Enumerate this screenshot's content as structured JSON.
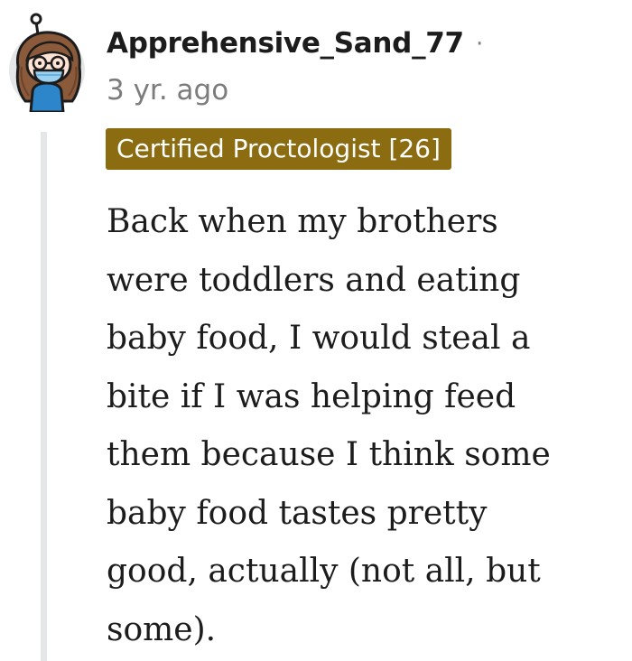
{
  "comment": {
    "username": "Apprehensive_Sand_77",
    "separator": "·",
    "timestamp": "3 yr. ago",
    "flair": "Certified Proctologist [26]",
    "body_lines": [
      "Back when my brothers",
      "were toddlers and eating",
      "baby food, I would steal a",
      "bite if I was helping feed",
      "them because I think some",
      "baby food tastes pretty",
      "good, actually (not all, but",
      "some)."
    ]
  },
  "icons": {
    "avatar": "user-avatar-icon"
  },
  "colors": {
    "flair_background": "#8b6c11",
    "flair_text": "#ffffff",
    "username": "#1c1c1c",
    "meta": "#7c7c7c",
    "thread_line": "#e4e6e8"
  }
}
